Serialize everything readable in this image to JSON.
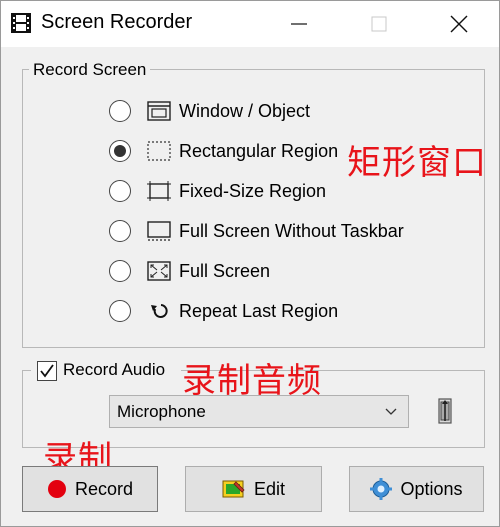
{
  "window": {
    "title": "Screen Recorder"
  },
  "record_screen": {
    "legend": "Record Screen",
    "options": [
      {
        "label": "Window / Object",
        "icon": "window-icon",
        "selected": false
      },
      {
        "label": "Rectangular Region",
        "icon": "dashed-rectangle-icon",
        "selected": true
      },
      {
        "label": "Fixed-Size Region",
        "icon": "fixed-size-region-icon",
        "selected": false
      },
      {
        "label": "Full Screen Without Taskbar",
        "icon": "screen-without-taskbar-icon",
        "selected": false
      },
      {
        "label": "Full Screen",
        "icon": "full-screen-icon",
        "selected": false
      },
      {
        "label": "Repeat Last Region",
        "icon": "repeat-arrow-icon",
        "selected": false
      }
    ]
  },
  "audio": {
    "checkbox_label": "Record Audio",
    "checked": true,
    "device": "Microphone"
  },
  "buttons": {
    "record": "Record",
    "edit": "Edit",
    "options": "Options"
  },
  "annotations": {
    "rect_region": "矩形窗口",
    "record_audio": "录制音频",
    "record": "录制",
    "color": "#e8141a"
  },
  "colors": {
    "record_dot": "#e3000f",
    "window_bg": "#f0f0f0"
  }
}
